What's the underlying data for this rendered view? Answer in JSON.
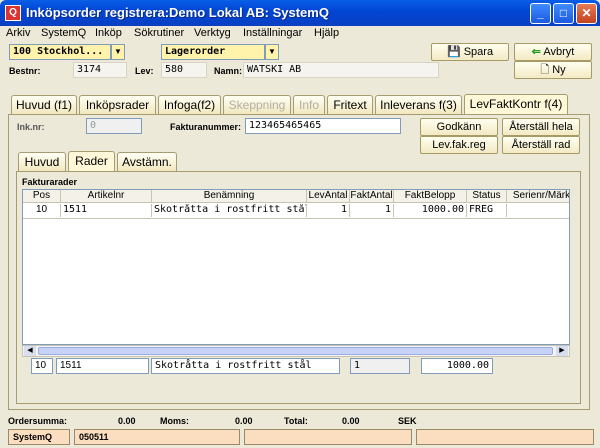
{
  "window": {
    "title": "Inköpsorder registrera:Demo Lokal AB: SystemQ",
    "app_icon": "app-icon"
  },
  "menu": [
    "Arkiv",
    "SystemQ",
    "Inköp",
    "Sökrutiner",
    "Verktyg",
    "Inställningar",
    "Hjälp"
  ],
  "header": {
    "store": "100   Stockhol...",
    "order_type": "Lagerorder",
    "bestnr_label": "Bestnr:",
    "bestnr": "3174",
    "lev_label": "Lev:",
    "lev": "580",
    "namn_label": "Namn:",
    "namn": "WATSKI AB",
    "spara": "Spara",
    "avbryt": "Avbryt",
    "ny": "Ny"
  },
  "tabs": [
    "Huvud (f1)",
    "Inköpsrader",
    "Infoga(f2)",
    "Skeppning",
    "Info",
    "Fritext",
    "Inleverans f(3)",
    "LevFaktKontr f(4)"
  ],
  "invoice": {
    "inknr_label": "Ink.nr:",
    "inknr": "0",
    "fakturanummer_label": "Fakturanummer:",
    "fakturanummer": "123465465465",
    "godkann": "Godkänn",
    "aterstall_hela": "Återställ hela",
    "levfakreg": "Lev.fak.reg",
    "aterstall_rad": "Återställ rad"
  },
  "subtabs": [
    "Huvud",
    "Rader",
    "Avstämn."
  ],
  "grid": {
    "title": "Fakturarader",
    "columns": [
      "Pos",
      "Artikelnr",
      "Benämning",
      "LevAntal",
      "FaktAntal",
      "FaktBelopp",
      "Status",
      "Serienr/Märk"
    ],
    "rows": [
      [
        "10",
        "1511",
        "Skotråtta i rostfritt stål",
        "1",
        "1",
        "1000.00",
        "FREG",
        ""
      ]
    ]
  },
  "edit_row": {
    "pos": "10",
    "artikelnr": "1511",
    "benamning": "Skotråtta i rostfritt stål",
    "antal": "1",
    "belopp": "1000.00"
  },
  "totals": {
    "ordersumma_label": "Ordersumma:",
    "ordersumma": "0.00",
    "moms_label": "Moms:",
    "moms": "0.00",
    "total_label": "Total:",
    "total": "0.00",
    "currency": "SEK"
  },
  "status": {
    "app": "SystemQ",
    "code": "050511"
  }
}
